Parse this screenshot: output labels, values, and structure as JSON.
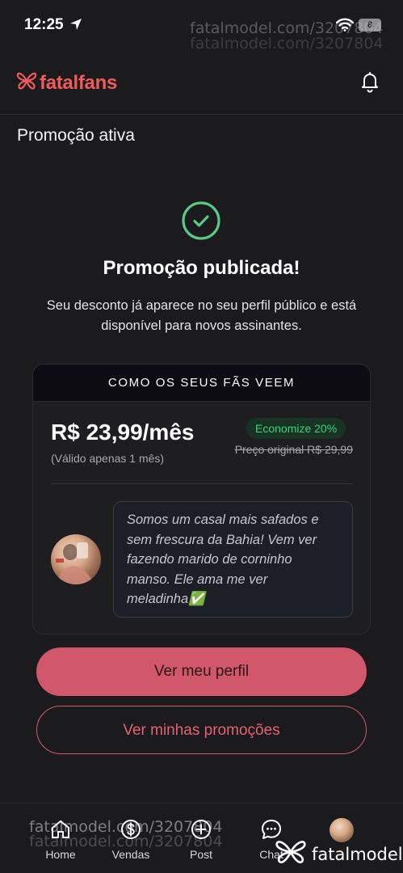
{
  "status_bar": {
    "time": "12:25",
    "battery": "8",
    "icons": [
      "location-arrow-icon",
      "wifi-icon",
      "battery-icon"
    ]
  },
  "watermark": {
    "text": "fatalmodel.com/3207804"
  },
  "header": {
    "logo_text": "fatalfans",
    "logo_color": "#ef5a5a",
    "icons": [
      "butterfly-logo-icon",
      "bell-icon"
    ]
  },
  "page": {
    "title": "Promoção ativa",
    "headline": "Promoção publicada!",
    "subtext": "Seu desconto já aparece no seu perfil público e está disponível para novos assinantes.",
    "status_icon": "check-circle-icon",
    "status_color": "#58c987"
  },
  "preview": {
    "header": "COMO OS SEUS FÃS VEEM",
    "price": "R$ 23,99/mês",
    "validity": "(Válido apenas 1 mês)",
    "discount_badge": "Economize 20%",
    "original_price": "Preço original R$ 29,99",
    "bio": "Somos um casal mais safados e sem frescura da Bahia! Vem ver fazendo marido de corninho manso. Ele ama me ver meladinha✅",
    "badge_color": "#37d27a"
  },
  "actions": {
    "primary_label": "Ver meu perfil",
    "secondary_label": "Ver minhas promoções",
    "accent_color": "#d0586a"
  },
  "bottom_nav": {
    "items": [
      {
        "label": "Home",
        "icon": "home-icon"
      },
      {
        "label": "Vendas",
        "icon": "dollar-circle-icon"
      },
      {
        "label": "Post",
        "icon": "plus-circle-icon"
      },
      {
        "label": "Chat",
        "icon": "chat-bubble-icon"
      },
      {
        "label": "",
        "icon": "profile-avatar"
      }
    ]
  },
  "brand_mark": {
    "text": "fatalmodel",
    "icon": "butterfly-logo-icon"
  }
}
